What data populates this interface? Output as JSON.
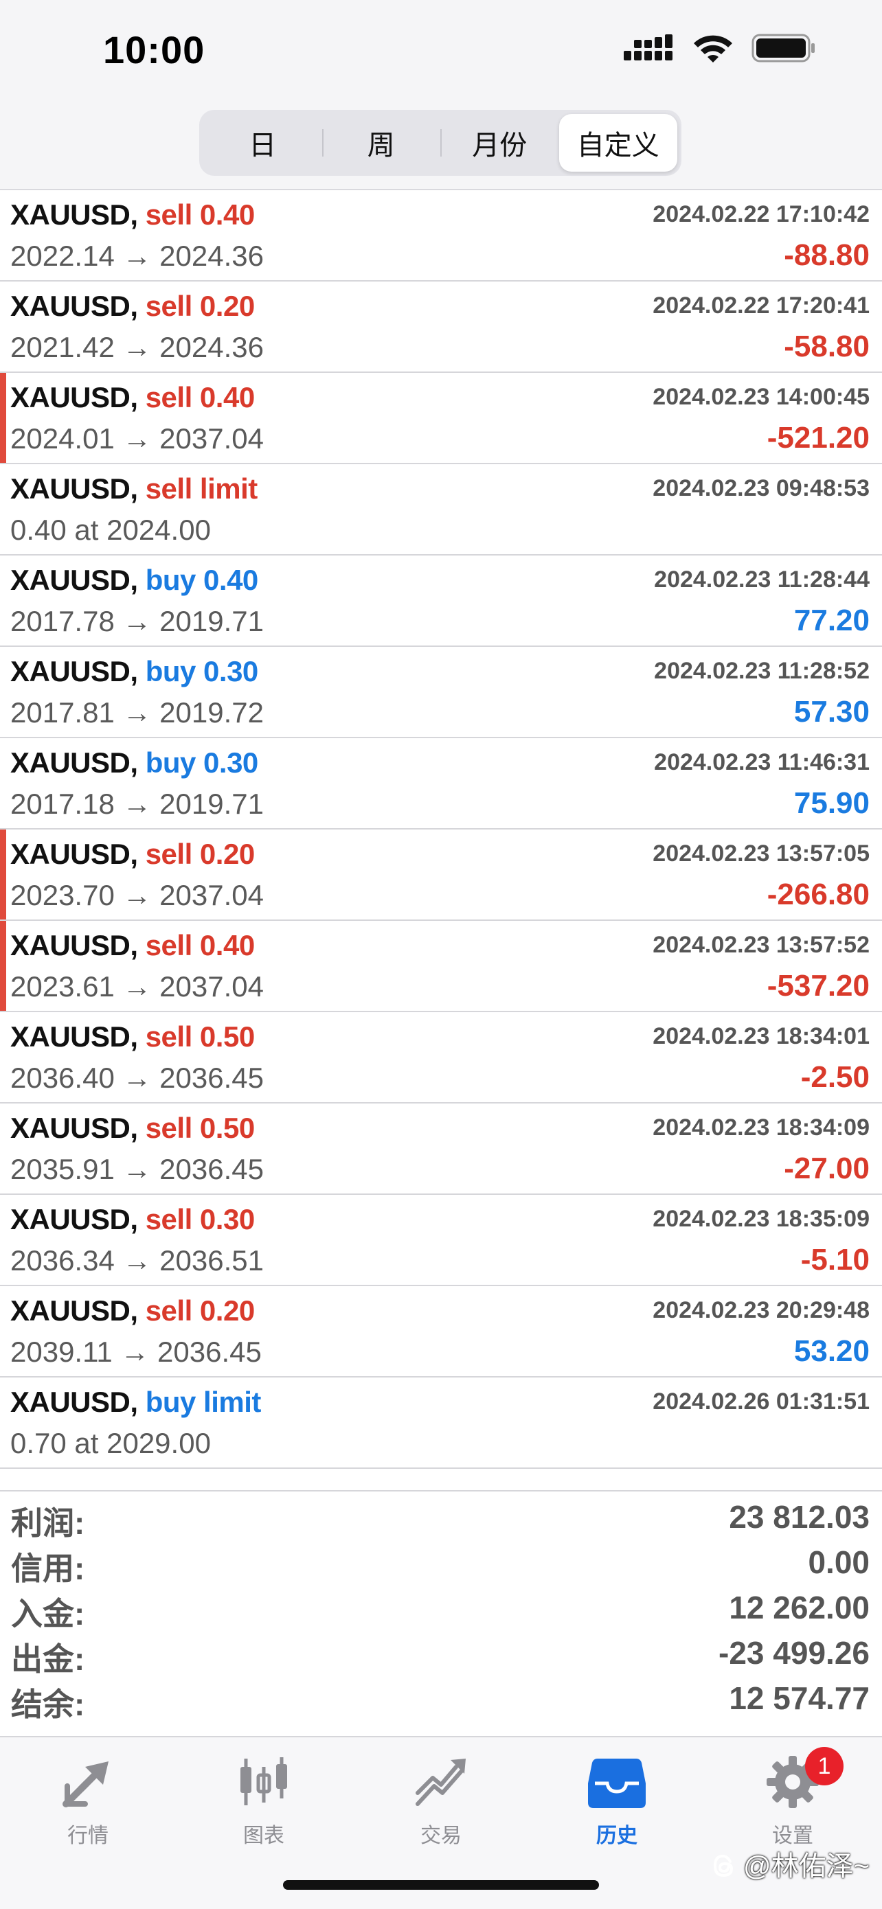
{
  "status_bar": {
    "time": "10:00"
  },
  "tabs": [
    "日",
    "周",
    "月份",
    "自定义"
  ],
  "active_tab": 3,
  "orders": [
    {
      "symbol": "XAUUSD,",
      "side": "sell 0.40",
      "side_color": "#d93a2b",
      "prices": "2022.14 → 2024.36",
      "time": "2024.02.22 17:10:42",
      "profit": "-88.80",
      "profit_color": "#d93a2b",
      "marked": false
    },
    {
      "symbol": "XAUUSD,",
      "side": "sell 0.20",
      "side_color": "#d93a2b",
      "prices": "2021.42 → 2024.36",
      "time": "2024.02.22 17:20:41",
      "profit": "-58.80",
      "profit_color": "#d93a2b",
      "marked": false
    },
    {
      "symbol": "XAUUSD,",
      "side": "sell 0.40",
      "side_color": "#d93a2b",
      "prices": "2024.01 → 2037.04",
      "time": "2024.02.23 14:00:45",
      "profit": "-521.20",
      "profit_color": "#d93a2b",
      "marked": true
    },
    {
      "symbol": "XAUUSD,",
      "side": "sell limit",
      "side_color": "#d93a2b",
      "prices": "0.40 at 2024.00",
      "time": "2024.02.23 09:48:53",
      "profit": "",
      "profit_color": "#d93a2b",
      "marked": false
    },
    {
      "symbol": "XAUUSD,",
      "side": "buy 0.40",
      "side_color": "#1a7be0",
      "prices": "2017.78 → 2019.71",
      "time": "2024.02.23 11:28:44",
      "profit": "77.20",
      "profit_color": "#1a7be0",
      "marked": false
    },
    {
      "symbol": "XAUUSD,",
      "side": "buy 0.30",
      "side_color": "#1a7be0",
      "prices": "2017.81 → 2019.72",
      "time": "2024.02.23 11:28:52",
      "profit": "57.30",
      "profit_color": "#1a7be0",
      "marked": false
    },
    {
      "symbol": "XAUUSD,",
      "side": "buy 0.30",
      "side_color": "#1a7be0",
      "prices": "2017.18 → 2019.71",
      "time": "2024.02.23 11:46:31",
      "profit": "75.90",
      "profit_color": "#1a7be0",
      "marked": false
    },
    {
      "symbol": "XAUUSD,",
      "side": "sell 0.20",
      "side_color": "#d93a2b",
      "prices": "2023.70 → 2037.04",
      "time": "2024.02.23 13:57:05",
      "profit": "-266.80",
      "profit_color": "#d93a2b",
      "marked": true
    },
    {
      "symbol": "XAUUSD,",
      "side": "sell 0.40",
      "side_color": "#d93a2b",
      "prices": "2023.61 → 2037.04",
      "time": "2024.02.23 13:57:52",
      "profit": "-537.20",
      "profit_color": "#d93a2b",
      "marked": true
    },
    {
      "symbol": "XAUUSD,",
      "side": "sell 0.50",
      "side_color": "#d93a2b",
      "prices": "2036.40 → 2036.45",
      "time": "2024.02.23 18:34:01",
      "profit": "-2.50",
      "profit_color": "#d93a2b",
      "marked": false
    },
    {
      "symbol": "XAUUSD,",
      "side": "sell 0.50",
      "side_color": "#d93a2b",
      "prices": "2035.91 → 2036.45",
      "time": "2024.02.23 18:34:09",
      "profit": "-27.00",
      "profit_color": "#d93a2b",
      "marked": false
    },
    {
      "symbol": "XAUUSD,",
      "side": "sell 0.30",
      "side_color": "#d93a2b",
      "prices": "2036.34 → 2036.51",
      "time": "2024.02.23 18:35:09",
      "profit": "-5.10",
      "profit_color": "#d93a2b",
      "marked": false
    },
    {
      "symbol": "XAUUSD,",
      "side": "sell 0.20",
      "side_color": "#d93a2b",
      "prices": "2039.11 → 2036.45",
      "time": "2024.02.23 20:29:48",
      "profit": "53.20",
      "profit_color": "#1a7be0",
      "marked": false
    },
    {
      "symbol": "XAUUSD,",
      "side": "buy limit",
      "side_color": "#1a7be0",
      "prices": "0.70 at 2029.00",
      "time": "2024.02.26 01:31:51",
      "profit": "",
      "profit_color": "#1a7be0",
      "marked": false
    }
  ],
  "summary": [
    {
      "label": "利润:",
      "value": "23 812.03"
    },
    {
      "label": "信用:",
      "value": "0.00"
    },
    {
      "label": "入金:",
      "value": "12 262.00"
    },
    {
      "label": "出金:",
      "value": "-23 499.26"
    },
    {
      "label": "结余:",
      "value": "12 574.77"
    }
  ],
  "tabbar": [
    {
      "label": "行情",
      "icon": "quotes-arrows-icon"
    },
    {
      "label": "图表",
      "icon": "candlestick-chart-icon"
    },
    {
      "label": "交易",
      "icon": "trade-chart-icon"
    },
    {
      "label": "历史",
      "icon": "history-inbox-icon",
      "active": true
    },
    {
      "label": "设置",
      "icon": "gear-icon",
      "badge": "1"
    }
  ],
  "watermark": "@林佑泽~",
  "colors": {
    "sell": "#d93a2b",
    "buy": "#1a7be0",
    "active_tab": "#1a6fe0",
    "badge": "#e8212a"
  }
}
